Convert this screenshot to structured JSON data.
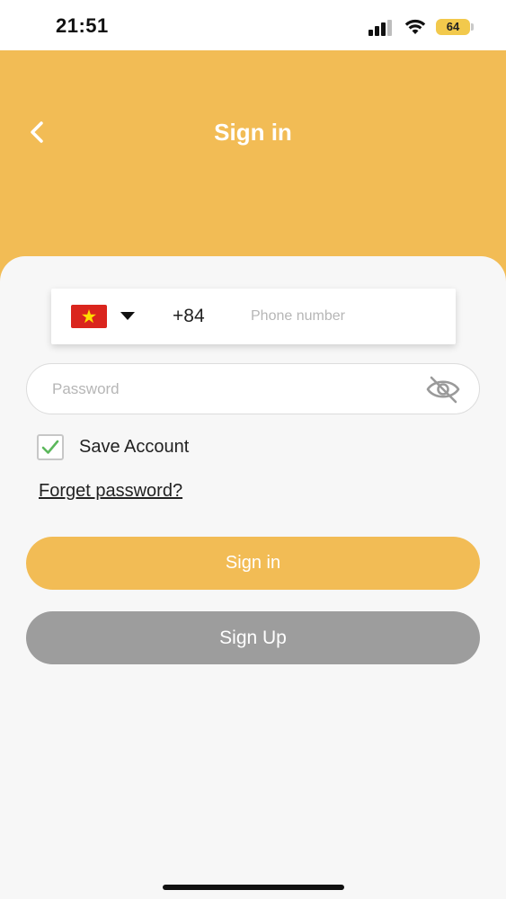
{
  "status_bar": {
    "time": "21:51",
    "battery": "64",
    "icons": [
      "signal-icon",
      "wifi-icon",
      "battery-icon"
    ]
  },
  "header": {
    "title": "Sign in",
    "back_icon": "chevron-left-icon"
  },
  "phone": {
    "country_flag": "vietnam-flag-icon",
    "country_code": "+84",
    "placeholder": "Phone number",
    "value": ""
  },
  "password": {
    "placeholder": "Password",
    "value": "",
    "toggle_icon": "eye-off-icon"
  },
  "save_account": {
    "label": "Save Account",
    "checked": true
  },
  "forget_password": "Forget password?",
  "buttons": {
    "sign_in": "Sign in",
    "sign_up": "Sign Up"
  },
  "colors": {
    "accent": "#f2bc55",
    "secondary_button": "#9d9d9d",
    "background": "#f7f7f7",
    "check": "#5cb85c"
  }
}
